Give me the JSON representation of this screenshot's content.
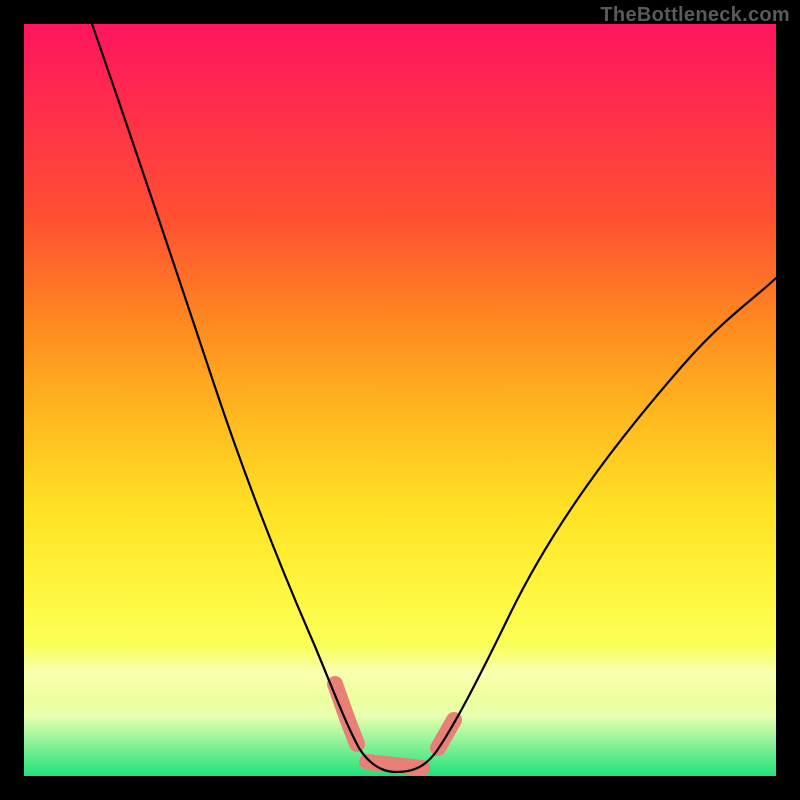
{
  "watermark": {
    "text": "TheBottleneck.com"
  },
  "colors": {
    "frame": "#000000",
    "curve": "#000000",
    "marker": "#e98076",
    "gradient_top": "#ff1560",
    "gradient_bottom": "#1fe27a"
  },
  "chart_data": {
    "type": "line",
    "title": "",
    "xlabel": "",
    "ylabel": "",
    "xlim": [
      0,
      100
    ],
    "ylim": [
      0,
      100
    ],
    "grid": false,
    "background": "vertical rainbow gradient (red→orange→yellow→green)",
    "series": [
      {
        "name": "bottleneck-curve",
        "x": [
          9,
          14,
          18,
          22,
          26,
          30,
          34,
          37,
          40,
          42,
          43,
          45,
          47,
          49,
          51,
          53,
          55,
          58,
          62,
          68,
          76,
          86,
          98,
          100
        ],
        "values": [
          100,
          86,
          74,
          62,
          51,
          41,
          32,
          24,
          16,
          10,
          6,
          3,
          1,
          0,
          0,
          1,
          3,
          6,
          12,
          22,
          36,
          50,
          64,
          66
        ]
      }
    ],
    "annotations": [
      {
        "name": "valley-markers-left",
        "type": "rounded-segment",
        "x_range": [
          41,
          44.5
        ],
        "y_range": [
          3,
          12
        ],
        "color": "#e98076"
      },
      {
        "name": "valley-floor",
        "type": "rounded-segment",
        "x_range": [
          45,
          53
        ],
        "y_range": [
          0,
          2
        ],
        "color": "#e98076"
      },
      {
        "name": "valley-markers-right",
        "type": "rounded-segment",
        "x_range": [
          54.5,
          57.5
        ],
        "y_range": [
          3,
          8
        ],
        "color": "#e98076"
      }
    ]
  }
}
